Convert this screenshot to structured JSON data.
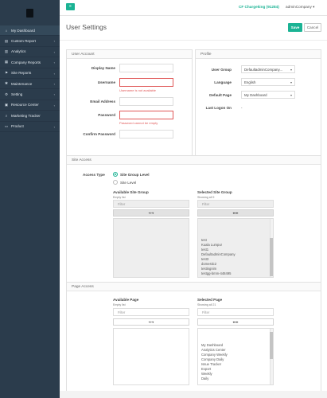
{
  "sidebar": {
    "items": [
      {
        "label": "My Dashboard",
        "icon": "home-icon",
        "glyph": "⌂",
        "has_sub": false
      },
      {
        "label": "Custom Report",
        "icon": "report-icon",
        "glyph": "▤",
        "has_sub": true
      },
      {
        "label": "Analytics",
        "icon": "bar-chart-icon",
        "glyph": "▥",
        "has_sub": true
      },
      {
        "label": "Company Reports",
        "icon": "building-icon",
        "glyph": "▦",
        "has_sub": true
      },
      {
        "label": "Site Reports",
        "icon": "flag-icon",
        "glyph": "⚑",
        "has_sub": true
      },
      {
        "label": "Maintenance",
        "icon": "wrench-icon",
        "glyph": "✱",
        "has_sub": true
      },
      {
        "label": "Setting",
        "icon": "gear-icon",
        "glyph": "⚙",
        "has_sub": true
      },
      {
        "label": "Resource Center",
        "icon": "book-icon",
        "glyph": "▣",
        "has_sub": true
      },
      {
        "label": "Marketing Tracker",
        "icon": "search-icon",
        "glyph": "⌕",
        "has_sub": false
      },
      {
        "label": "Product",
        "icon": "folder-icon",
        "glyph": "▭",
        "has_sub": true
      }
    ]
  },
  "topbar": {
    "menu_icon": "hamburger-icon",
    "menu_glyph": "≡",
    "site": "CF Chargeking (91284)",
    "user": "adminCompany",
    "user_caret": "▾"
  },
  "page": {
    "title": "User Settings",
    "save": "Save",
    "cancel": "Cancel"
  },
  "account": {
    "heading": "User Account",
    "display_name_label": "Display Name",
    "username_label": "Username",
    "username_error": "Username is not available",
    "email_label": "Email Address",
    "password_label": "Password",
    "password_error": "Password cannot be empty",
    "confirm_label": "Confirm Password"
  },
  "profile": {
    "heading": "Profile",
    "user_group_label": "User Group",
    "user_group_value": "DefaultadminCompany...",
    "language_label": "Language",
    "language_value": "English",
    "default_page_label": "Default Page",
    "default_page_value": "My Dashboard",
    "last_logon_label": "Last Logon On",
    "last_logon_value": "-",
    "caret": "▾"
  },
  "site_access": {
    "heading": "Site Access",
    "access_type_label": "Access Type",
    "option_group": "Site Group Level",
    "option_site": "Site Level",
    "available_title": "Available Site Group",
    "available_sub": "Empty list",
    "selected_title": "Selected Site Group",
    "selected_sub": "Showing all 9",
    "filter_placeholder": "Filter",
    "move_all_right": "➔➔",
    "move_all_left": "⬅⬅",
    "selected_items": [
      "test",
      "Kuala Lumpur",
      "test1",
      "DefaultadminCompany",
      "test3",
      "domestic2",
      "testingnim",
      "testgg-bmm-448495"
    ]
  },
  "page_access": {
    "heading": "Page Access",
    "available_title": "Available Page",
    "available_sub": "Empty list",
    "selected_title": "Selected Page",
    "selected_sub": "Showing all 21",
    "filter_placeholder": "Filter",
    "move_all_right": "➔➔",
    "move_all_left": "⬅⬅",
    "selected_items": [
      "My Dashboard",
      "Analytics Center",
      "Company Weekly",
      "Company Daily",
      "Issue Tracker",
      "Export",
      "Weekly",
      "Daily"
    ]
  },
  "colors": {
    "accent": "#1bb394",
    "sidebar": "#2b3c4c",
    "error": "#e05858"
  }
}
